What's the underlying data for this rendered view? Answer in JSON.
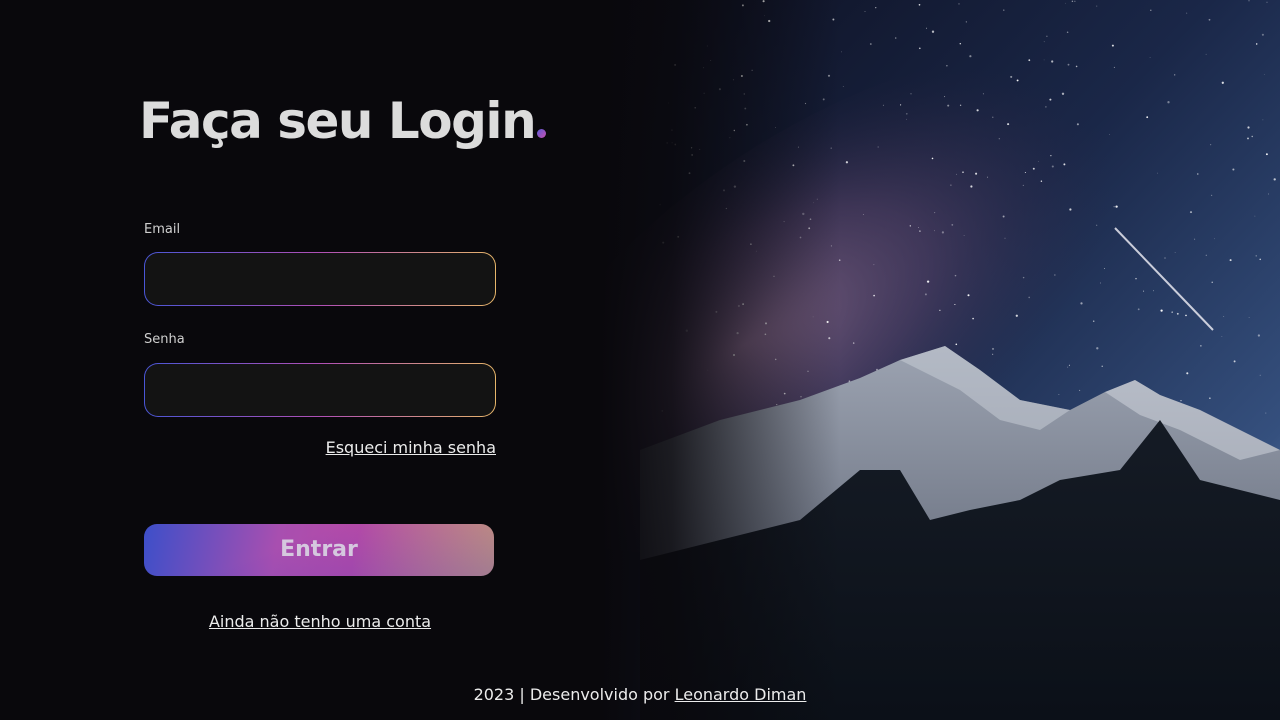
{
  "login": {
    "title": "Faça seu Login",
    "email_label": "Email",
    "email_value": "",
    "password_label": "Senha",
    "password_value": "",
    "forgot_link": "Esqueci minha senha",
    "submit_label": "Entrar",
    "signup_link": "Ainda não tenho uma conta"
  },
  "footer": {
    "text": "2023 | Desenvolvido por",
    "author_link": "Leonardo Diman"
  },
  "colors": {
    "background": "#09080c",
    "gradient_start": "#4a56d6",
    "gradient_mid": "#b04fb5",
    "gradient_end": "#e6b56a"
  }
}
